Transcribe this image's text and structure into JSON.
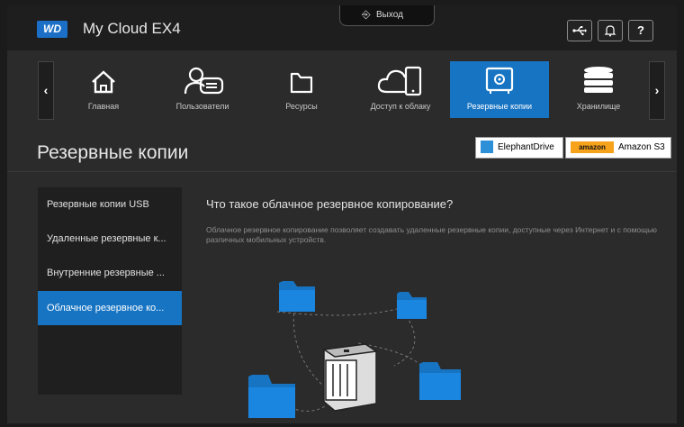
{
  "header": {
    "logo": "WD",
    "product_name": "My Cloud EX4",
    "logout_label": "Выход",
    "buttons": [
      {
        "icon": "usb-icon",
        "label": "⇌"
      },
      {
        "icon": "bell-icon",
        "label": "♫"
      },
      {
        "icon": "help-icon",
        "label": "?"
      }
    ]
  },
  "nav": {
    "items": [
      {
        "label": "Главная",
        "icon": "home-icon"
      },
      {
        "label": "Пользователи",
        "icon": "users-icon"
      },
      {
        "label": "Ресурсы",
        "icon": "folder-icon"
      },
      {
        "label": "Доступ к облаку",
        "icon": "cloud-access-icon"
      },
      {
        "label": "Резервные копии",
        "icon": "backup-safe-icon",
        "active": true
      },
      {
        "label": "Хранилище",
        "icon": "storage-icon"
      }
    ]
  },
  "page": {
    "title": "Резервные копии",
    "partners": [
      "ElephantDrive",
      "Amazon S3"
    ],
    "amazon_badge": "amazon"
  },
  "sidebar": {
    "items": [
      {
        "label": "Резервные копии USB"
      },
      {
        "label": "Удаленные резервные к..."
      },
      {
        "label": "Внутренние резервные ..."
      },
      {
        "label": "Облачное резервное ко...",
        "active": true
      }
    ]
  },
  "content": {
    "heading": "Что такое облачное резервное копирование?",
    "description": "Облачное резервное копирование позволяет создавать удаленные резервные копии, доступные через Интернет и с помощью различных мобильных устройств."
  },
  "colors": {
    "accent": "#1774c3",
    "background": "#2b2b2b",
    "bar": "#1e1e1e"
  }
}
